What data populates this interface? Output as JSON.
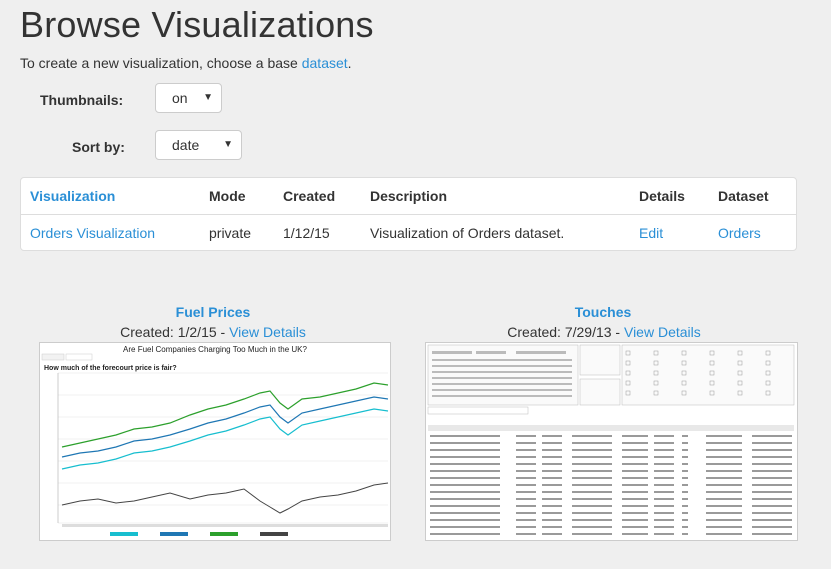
{
  "page": {
    "title": "Browse Visualizations",
    "intro_text": "To create a new visualization, choose a base",
    "intro_link": "dataset",
    "intro_end": "."
  },
  "controls": {
    "thumbnails_label": "Thumbnails:",
    "thumbnails_value": "on",
    "sortby_label": "Sort by:",
    "sortby_value": "date"
  },
  "table": {
    "headers": [
      "Visualization",
      "Mode",
      "Created",
      "Description",
      "Details",
      "Dataset"
    ],
    "rows": [
      {
        "name": "Orders Visualization",
        "mode": "private",
        "created": "1/12/15",
        "description": "Visualization of Orders dataset.",
        "details": "Edit",
        "dataset": "Orders"
      }
    ]
  },
  "cards": [
    {
      "title": "Fuel Prices",
      "created_prefix": "Created: 1/2/15 - ",
      "details_link": "View Details",
      "thumb_title": "Are Fuel Companies Charging Too Much in the UK?",
      "thumb_subtitle": "How much of the forecourt price is fair?"
    },
    {
      "title": "Touches",
      "created_prefix": "Created: 7/29/13 - ",
      "details_link": "View Details"
    }
  ],
  "colors": {
    "link": "#2a8fd6",
    "background": "#efefef"
  }
}
